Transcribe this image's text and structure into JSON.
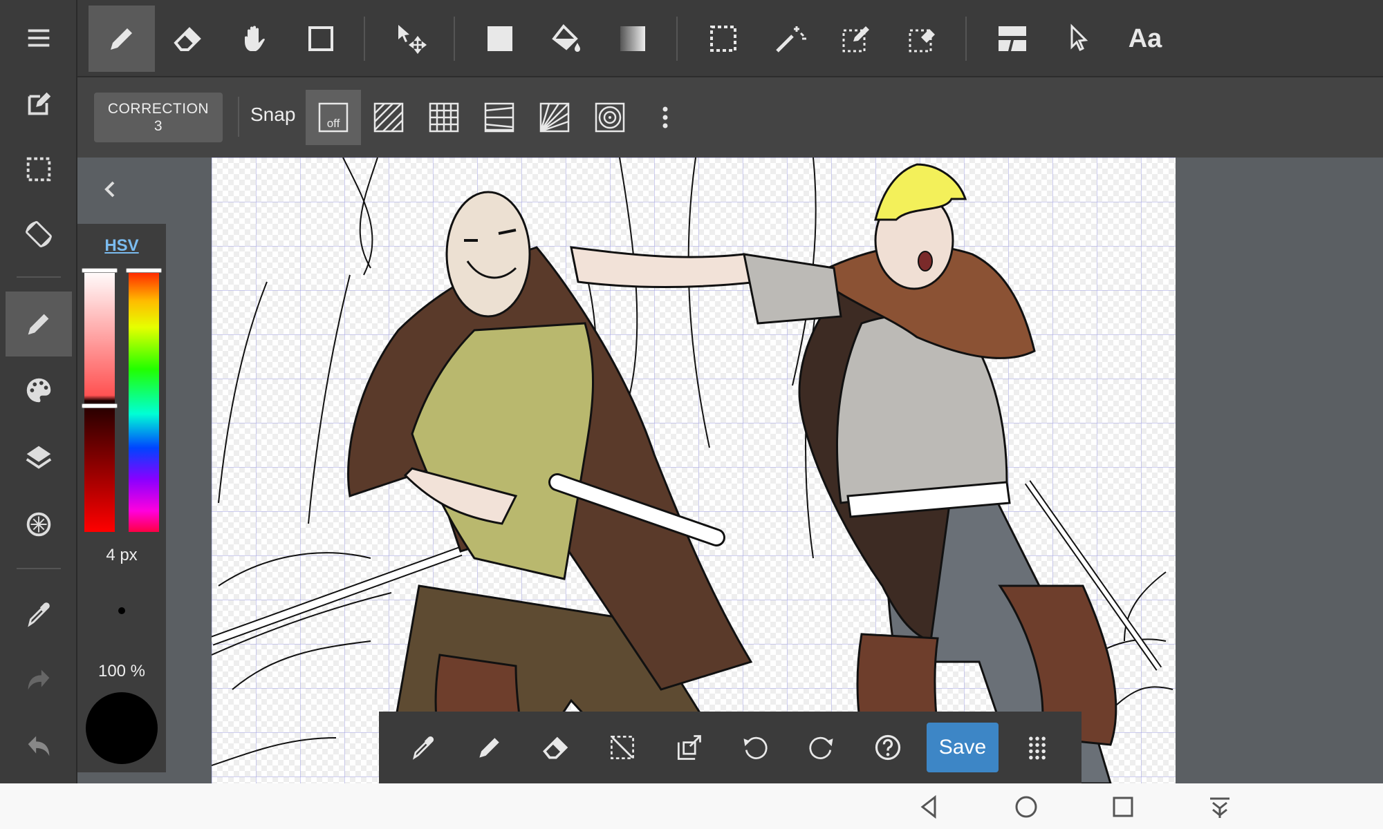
{
  "sidebar": {
    "items": [
      {
        "icon": "menu-icon"
      },
      {
        "icon": "new-canvas-icon"
      },
      {
        "icon": "select-area-icon"
      },
      {
        "icon": "rotate-view-icon"
      },
      {
        "icon": "pen-icon",
        "active": true
      },
      {
        "icon": "palette-icon"
      },
      {
        "icon": "layers-icon"
      },
      {
        "icon": "brush-materials-icon"
      },
      {
        "icon": "eyedropper-icon"
      },
      {
        "icon": "redo-icon"
      },
      {
        "icon": "undo-icon"
      }
    ]
  },
  "toolbar": {
    "tools": [
      {
        "icon": "pen-icon",
        "active": true
      },
      {
        "icon": "eraser-icon"
      },
      {
        "icon": "hand-icon"
      },
      {
        "icon": "shape-icon"
      },
      {
        "icon": "move-icon"
      },
      {
        "icon": "fill-rect-icon"
      },
      {
        "icon": "bucket-icon"
      },
      {
        "icon": "gradient-icon"
      },
      {
        "icon": "rect-select-icon"
      },
      {
        "icon": "magic-wand-icon"
      },
      {
        "icon": "select-pen-icon"
      },
      {
        "icon": "select-eraser-icon"
      },
      {
        "icon": "frame-divider-icon"
      },
      {
        "icon": "operation-cursor-icon"
      }
    ],
    "text_tool_label": "Aa"
  },
  "subbar": {
    "correction_label": "CORRECTION",
    "correction_value": "3",
    "snap_label": "Snap",
    "snap_off_label": "off",
    "snap_modes": [
      "parallel-snap-icon",
      "grid-snap-icon",
      "vanishing-snap-icon",
      "radial-snap-icon",
      "circle-snap-icon"
    ],
    "more_icon": "more-vert-icon"
  },
  "color_panel": {
    "mode_label": "HSV",
    "brush_size": "4 px",
    "opacity": "100 %",
    "current_color": "#000000"
  },
  "bottom_bar": {
    "tools": [
      "eyedropper-icon",
      "pen-icon",
      "eraser-icon",
      "deselect-icon",
      "transform-icon",
      "undo-icon",
      "redo-icon",
      "help-icon"
    ],
    "save_label": "Save",
    "grid_icon": "apps-grid-icon"
  },
  "system_nav": [
    "back-icon",
    "home-icon",
    "recents-icon",
    "notifications-icon"
  ],
  "colors": {
    "accent": "#3d86c6",
    "toolbar_bg": "#3b3b3b",
    "hsv_link": "#7bbcf0"
  }
}
